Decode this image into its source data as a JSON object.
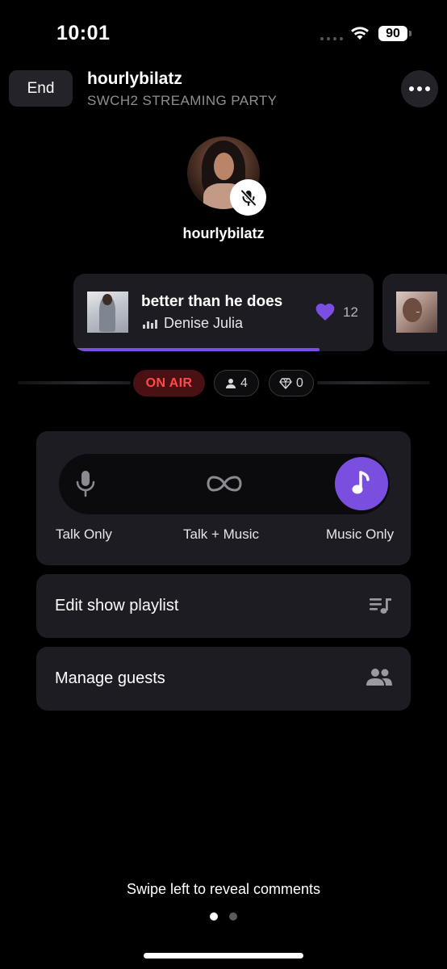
{
  "status_bar": {
    "time": "10:01",
    "battery": "90"
  },
  "header": {
    "end_label": "End",
    "title": "hourlybilatz",
    "subtitle": "SWCH2 STREAMING PARTY"
  },
  "host": {
    "name": "hourlybilatz",
    "muted": true
  },
  "now_playing": {
    "title": "better than he does",
    "artist": "Denise Julia",
    "likes": "12",
    "progress": 0.82
  },
  "on_air": {
    "badge": "ON AIR",
    "listeners": "4",
    "gems": "0"
  },
  "modes": {
    "talk": "Talk Only",
    "mix": "Talk + Music",
    "music": "Music Only",
    "selected": "music"
  },
  "actions": {
    "playlist": "Edit show playlist",
    "guests": "Manage guests"
  },
  "footer": {
    "hint": "Swipe left to reveal comments",
    "page_index": 0,
    "page_count": 2
  },
  "colors": {
    "accent": "#7a4fe0",
    "on_air_text": "#ff4a4a",
    "on_air_bg": "#4a1114",
    "card": "#1c1c22"
  }
}
